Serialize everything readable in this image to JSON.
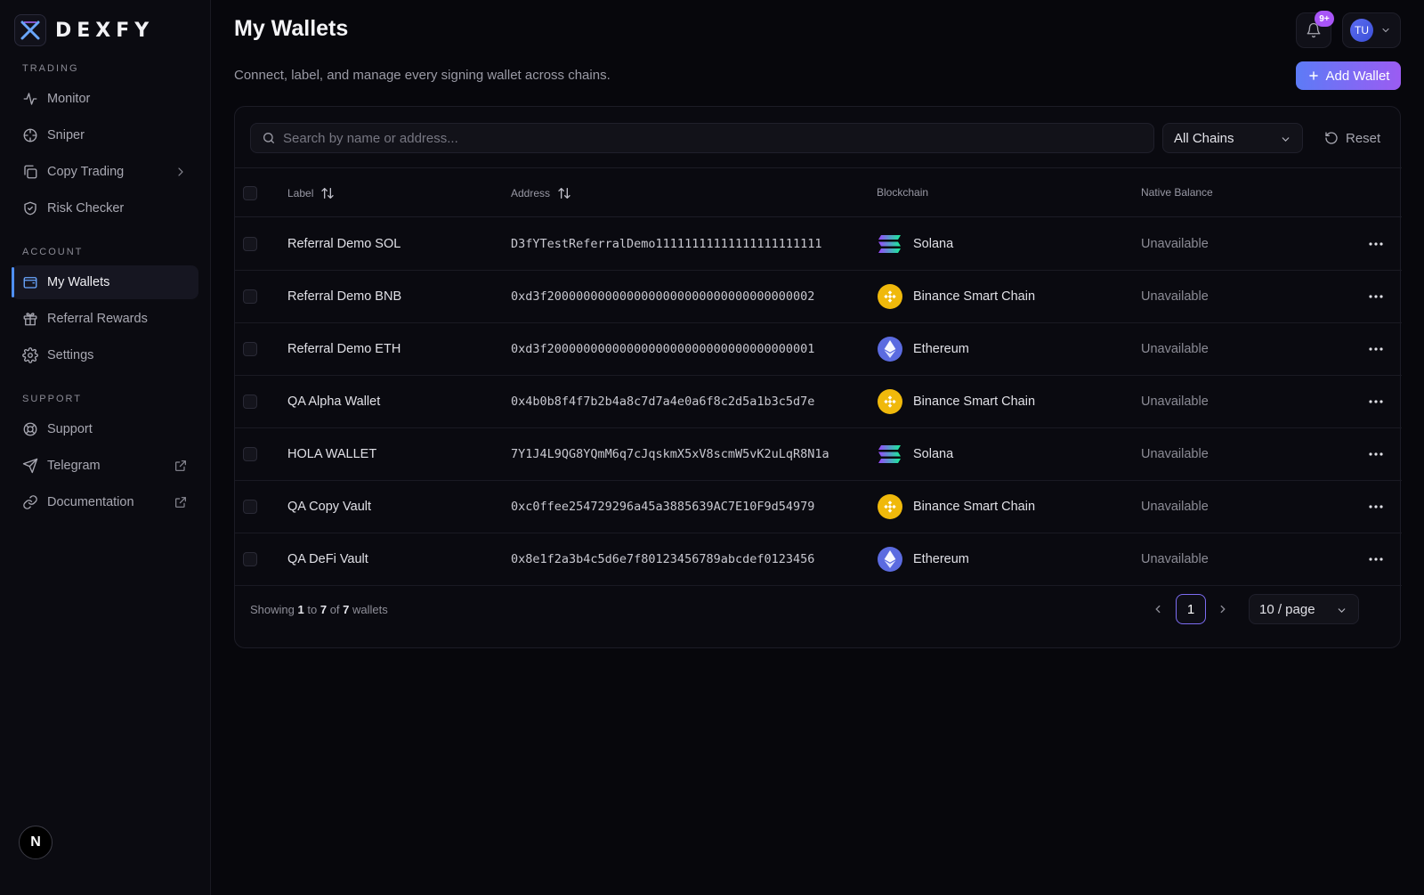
{
  "brand": {
    "name": "DEXFY"
  },
  "sidebar": {
    "sections": [
      {
        "title": "TRADING",
        "items": [
          {
            "label": "Monitor",
            "icon": "activity-icon"
          },
          {
            "label": "Sniper",
            "icon": "crosshair-icon"
          },
          {
            "label": "Copy Trading",
            "icon": "copy-icon",
            "trail": "chevron-right-icon"
          },
          {
            "label": "Risk Checker",
            "icon": "shield-check-icon"
          }
        ]
      },
      {
        "title": "ACCOUNT",
        "items": [
          {
            "label": "My Wallets",
            "icon": "wallet-icon",
            "active": true
          },
          {
            "label": "Referral Rewards",
            "icon": "gift-icon"
          },
          {
            "label": "Settings",
            "icon": "gear-icon"
          }
        ]
      },
      {
        "title": "SUPPORT",
        "items": [
          {
            "label": "Support",
            "icon": "lifebuoy-icon"
          },
          {
            "label": "Telegram",
            "icon": "send-icon",
            "trail": "external-link-icon"
          },
          {
            "label": "Documentation",
            "icon": "link-icon",
            "trail": "external-link-icon"
          }
        ]
      }
    ],
    "bottom_badge": "N"
  },
  "header": {
    "title": "My Wallets",
    "subtitle": "Connect, label, and manage every signing wallet across chains.",
    "notification_count": "9+",
    "avatar_initials": "TU",
    "add_button_label": "Add Wallet"
  },
  "filters": {
    "search_placeholder": "Search by name or address...",
    "chain_selected": "All Chains",
    "reset_label": "Reset"
  },
  "table": {
    "columns": {
      "label": "Label",
      "address": "Address",
      "blockchain": "Blockchain",
      "balance": "Native Balance"
    },
    "rows": [
      {
        "label": "Referral Demo SOL",
        "address": "D3fYTestReferralDemo11111111111111111111111",
        "chain": "Solana",
        "chain_key": "sol",
        "balance": "Unavailable"
      },
      {
        "label": "Referral Demo BNB",
        "address": "0xd3f2000000000000000000000000000000000002",
        "chain": "Binance Smart Chain",
        "chain_key": "bnb",
        "balance": "Unavailable"
      },
      {
        "label": "Referral Demo ETH",
        "address": "0xd3f2000000000000000000000000000000000001",
        "chain": "Ethereum",
        "chain_key": "eth",
        "balance": "Unavailable"
      },
      {
        "label": "QA Alpha Wallet",
        "address": "0x4b0b8f4f7b2b4a8c7d7a4e0a6f8c2d5a1b3c5d7e",
        "chain": "Binance Smart Chain",
        "chain_key": "bnb",
        "balance": "Unavailable"
      },
      {
        "label": "HOLA WALLET",
        "address": "7Y1J4L9QG8YQmM6q7cJqskmX5xV8scmW5vK2uLqR8N1a",
        "chain": "Solana",
        "chain_key": "sol",
        "balance": "Unavailable"
      },
      {
        "label": "QA Copy Vault",
        "address": "0xc0ffee254729296a45a3885639AC7E10F9d54979",
        "chain": "Binance Smart Chain",
        "chain_key": "bnb",
        "balance": "Unavailable"
      },
      {
        "label": "QA DeFi Vault",
        "address": "0x8e1f2a3b4c5d6e7f80123456789abcdef0123456",
        "chain": "Ethereum",
        "chain_key": "eth",
        "balance": "Unavailable"
      }
    ]
  },
  "footer": {
    "showing_prefix": "Showing",
    "range_start": "1",
    "to_word": "to",
    "range_end": "7",
    "of_word": "of",
    "total": "7",
    "suffix": "wallets",
    "current_page": "1",
    "per_page": "10 / page"
  },
  "colors": {
    "accent": "#5d7bf6",
    "accent_end": "#9b5cf2",
    "badge": "#a855f7",
    "bnb": "#f0b90b",
    "eth": "#5b6be0"
  }
}
